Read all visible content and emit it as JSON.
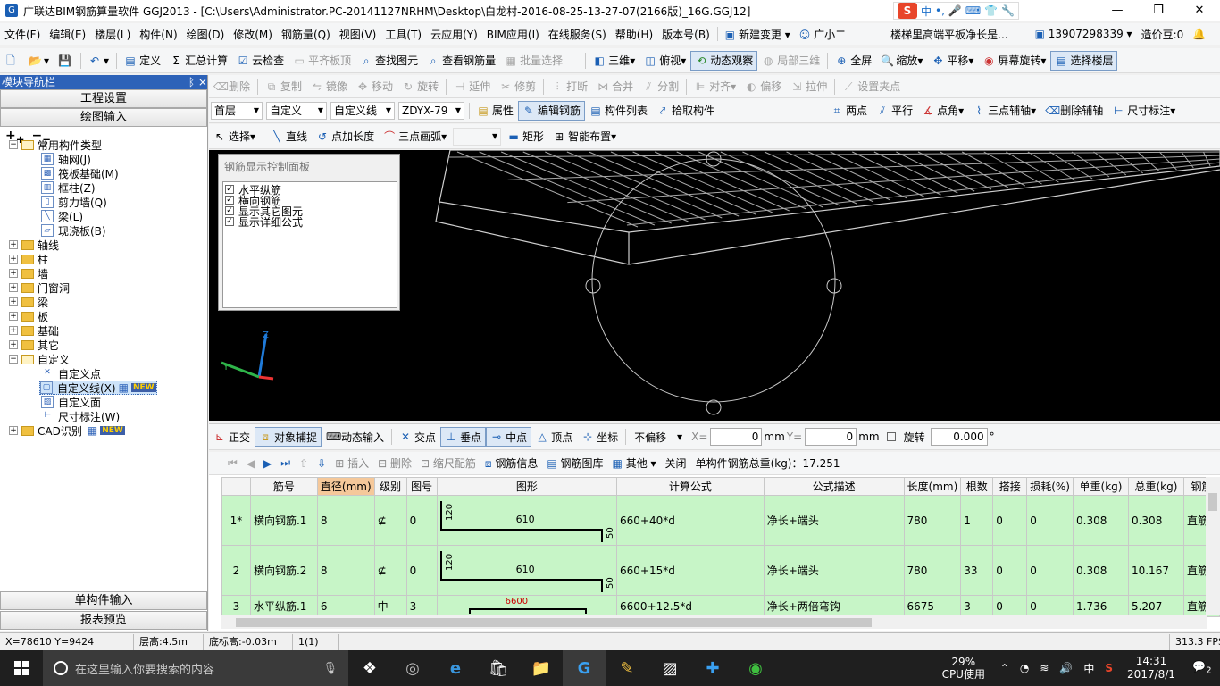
{
  "window": {
    "title": "广联达BIM钢筋算量软件 GGJ2013 - [C:\\Users\\Administrator.PC-20141127NRHM\\Desktop\\白龙村-2016-08-25-13-27-07(2166版)_16G.GGJ12]"
  },
  "ime": {
    "logo": "S",
    "items": [
      "中",
      "•,",
      "🎤",
      "⌨",
      "👕",
      "🔧"
    ]
  },
  "menu": {
    "items": [
      "文件(F)",
      "编辑(E)",
      "楼层(L)",
      "构件(N)",
      "绘图(D)",
      "修改(M)",
      "钢筋量(Q)",
      "视图(V)",
      "工具(T)",
      "云应用(Y)",
      "BIM应用(I)",
      "在线服务(S)",
      "帮助(H)",
      "版本号(B)"
    ],
    "new_change": "新建变更",
    "guang": "广小二",
    "question": "楼梯里高端平板净长是...",
    "phone": "13907298339",
    "price": "造价豆:0"
  },
  "toolbar1": [
    "定义",
    "汇总计算",
    "云检查",
    "平齐板顶",
    "查找图元",
    "查看钢筋量",
    "批量选择",
    "三维",
    "俯视",
    "动态观察",
    "局部三维",
    "全屏",
    "缩放",
    "平移",
    "屏幕旋转",
    "选择楼层"
  ],
  "toolbar2": [
    "删除",
    "复制",
    "镜像",
    "移动",
    "旋转",
    "延伸",
    "修剪",
    "打断",
    "合并",
    "分割",
    "对齐",
    "偏移",
    "拉伸",
    "设置夹点"
  ],
  "toolbar3": {
    "floor": "首层",
    "type": "自定义",
    "sub": "自定义线",
    "code": "ZDYX-79",
    "btns": [
      "属性",
      "编辑钢筋",
      "构件列表",
      "拾取构件"
    ],
    "right": [
      "两点",
      "平行",
      "点角",
      "三点辅轴",
      "删除辅轴",
      "尺寸标注"
    ]
  },
  "toolbar4": [
    "选择",
    "直线",
    "点加长度",
    "三点画弧",
    "矩形",
    "智能布置"
  ],
  "nav": {
    "title": "模块导航栏",
    "pin": "ᛒ ×",
    "btn1": "工程设置",
    "btn2": "绘图输入",
    "btn3": "单构件输入",
    "btn4": "报表预览"
  },
  "tree": {
    "common": "常用构件类型",
    "c1": "轴网(J)",
    "c2": "筏板基础(M)",
    "c3": "框柱(Z)",
    "c4": "剪力墙(Q)",
    "c5": "梁(L)",
    "c6": "现浇板(B)",
    "f1": "轴线",
    "f2": "柱",
    "f3": "墙",
    "f4": "门窗洞",
    "f5": "梁",
    "f6": "板",
    "f7": "基础",
    "f8": "其它",
    "f9": "自定义",
    "d1": "自定义点",
    "d2": "自定义线(X)",
    "d3": "自定义面",
    "d4": "尺寸标注(W)",
    "f10": "CAD识别",
    "new": "NEW"
  },
  "rebarpanel": {
    "title": "钢筋显示控制面板",
    "items": [
      "水平纵筋",
      "横向钢筋",
      "显示其它图元",
      "显示详细公式"
    ]
  },
  "snapbar": {
    "items": [
      "正交",
      "对象捕捉",
      "动态输入",
      "交点",
      "垂点",
      "中点",
      "顶点",
      "坐标"
    ],
    "offset": "不偏移",
    "x_label": "X=",
    "x": "0",
    "y_label": "Y=",
    "y": "0",
    "unit": "mm",
    "rotate": "旋转",
    "angle": "0.000",
    "deg": "°"
  },
  "gridbar": {
    "items": [
      "插入",
      "删除",
      "缩尺配筋",
      "钢筋信息",
      "钢筋图库",
      "其他",
      "关闭"
    ],
    "total": "单构件钢筋总重(kg)：17.251"
  },
  "table": {
    "headers": [
      "",
      "筋号",
      "直径(mm)",
      "级别",
      "图号",
      "图形",
      "计算公式",
      "公式描述",
      "长度(mm)",
      "根数",
      "搭接",
      "损耗(%)",
      "单重(kg)",
      "总重(kg)",
      "钢筋"
    ],
    "rows": [
      {
        "no": "1*",
        "name": "横向钢筋.1",
        "dia": "8",
        "grade": "⊈",
        "fig": "0",
        "s_left": "120",
        "s_mid": "610",
        "s_right": "50",
        "formula": "660+40*d",
        "desc": "净长+端头",
        "len": "780",
        "count": "1",
        "lap": "0",
        "loss": "0",
        "unit": "0.308",
        "total": "0.308",
        "kind": "直筋"
      },
      {
        "no": "2",
        "name": "横向钢筋.2",
        "dia": "8",
        "grade": "⊈",
        "fig": "0",
        "s_left": "120",
        "s_mid": "610",
        "s_right": "50",
        "formula": "660+15*d",
        "desc": "净长+端头",
        "len": "780",
        "count": "33",
        "lap": "0",
        "loss": "0",
        "unit": "0.308",
        "total": "10.167",
        "kind": "直筋"
      },
      {
        "no": "3",
        "name": "水平纵筋.1",
        "dia": "6",
        "grade": "中",
        "fig": "3",
        "s_mid": "6600",
        "formula": "6600+12.5*d",
        "desc": "净长+两倍弯钩",
        "len": "6675",
        "count": "3",
        "lap": "0",
        "loss": "0",
        "unit": "1.736",
        "total": "5.207",
        "kind": "直筋"
      }
    ]
  },
  "status": {
    "coords": "X=78610 Y=9424",
    "floor_h": "层高:4.5m",
    "base_h": "底标高:-0.03m",
    "sel": "1(1)",
    "fps": "313.3 FPS"
  },
  "taskbar": {
    "search": "在这里输入你要搜索的内容",
    "cpu": "29%",
    "cpu_label": "CPU使用",
    "lang": "中",
    "time": "14:31",
    "date": "2017/8/1",
    "notif": "2"
  },
  "colors": {
    "nav": "#2d62b8",
    "row": "#c7f5c7",
    "hl": "#f5c89a"
  }
}
